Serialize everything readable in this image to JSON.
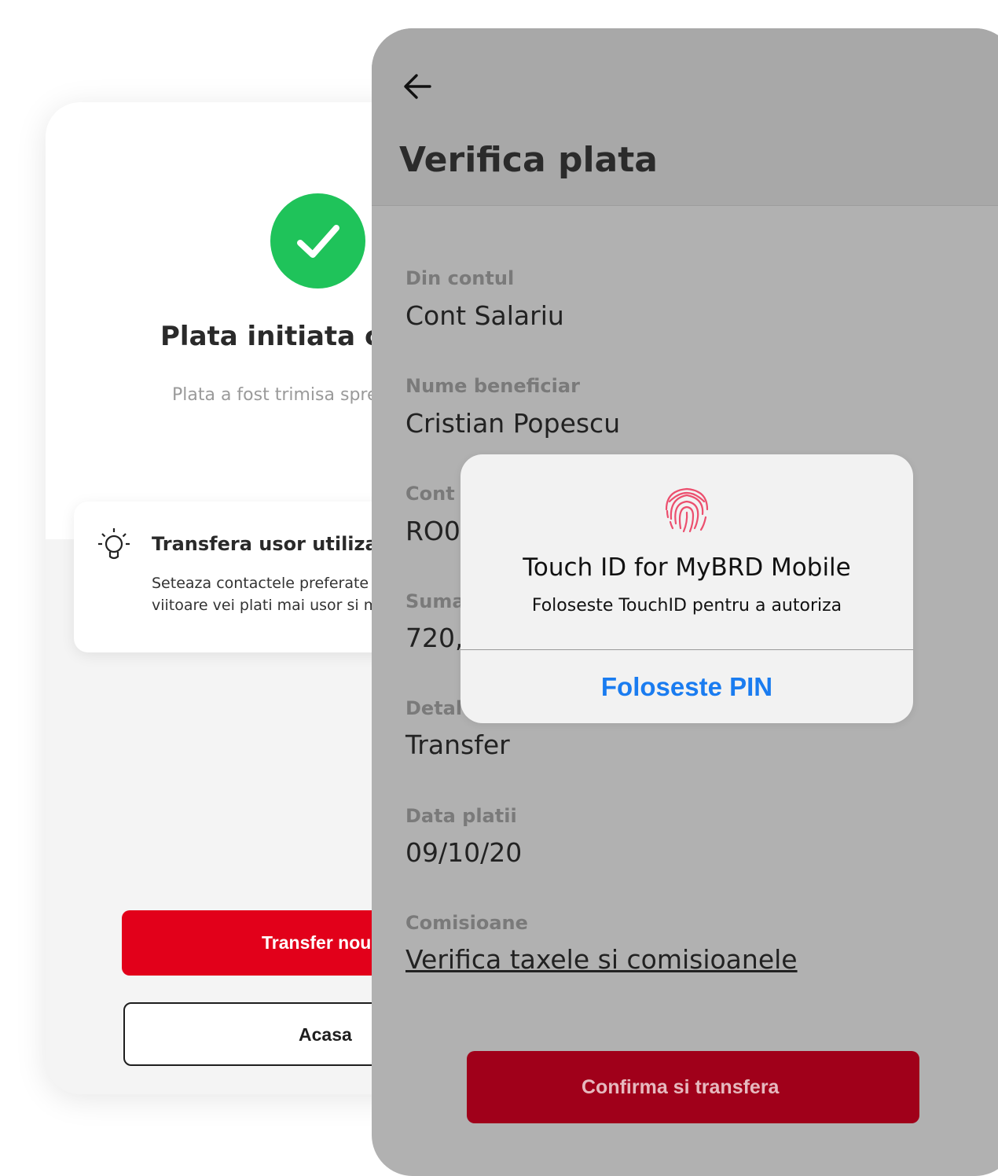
{
  "back_screen": {
    "success_title": "Plata initiata cu",
    "success_subtitle": "Plata a fost trimisa spre",
    "tip": {
      "title": "Transfera usor utilizand c",
      "body": "Seteaza contactele preferate s\nviitoare vei plati mai usor si m"
    },
    "primary_button": "Transfer nou",
    "secondary_button": "Acasa"
  },
  "front_screen": {
    "title": "Verifica plata",
    "fields": [
      {
        "label": "Din contul",
        "value": "Cont Salariu"
      },
      {
        "label": "Nume beneficiar",
        "value": "Cristian Popescu"
      },
      {
        "label": "Cont",
        "value": "RO0"
      },
      {
        "label": "Suma",
        "value": "720,"
      },
      {
        "label": "Detal",
        "value": "Transfer"
      },
      {
        "label": "Data platii",
        "value": "09/10/20"
      },
      {
        "label": "Comisioane",
        "value": "Verifica taxele si comisioanele"
      }
    ],
    "confirm_button": "Confirma si transfera"
  },
  "touch_dialog": {
    "title": "Touch ID for MyBRD Mobile",
    "message": "Foloseste TouchID pentru a autoriza",
    "button": "Foloseste PIN"
  },
  "icons": {
    "success": "check-icon",
    "tip": "lightbulb-icon",
    "back": "arrow-left-icon",
    "touch": "fingerprint-icon"
  },
  "colors": {
    "brand_red": "#e2001a",
    "confirm_red_dimmed": "#a0001a",
    "success_green": "#1fc35a",
    "ios_blue": "#1a7cf0",
    "overlay_gray": "#b1b1b1"
  }
}
